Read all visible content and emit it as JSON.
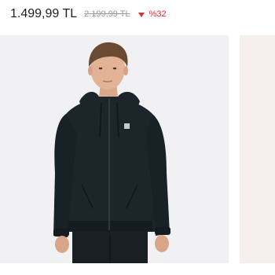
{
  "product": {
    "price_current": "1.499,99 TL",
    "price_old": "2.199,99 TL",
    "discount": "%32",
    "image_icon": "hoodie-photo",
    "image_bg": "#f1f1f3"
  },
  "colors": {
    "price": "#1d1d1f",
    "old_price": "#9a9a9a",
    "discount": "#d6303a",
    "next_card_bg": "#f6efec"
  },
  "icons": {
    "discount": "triangle-down-icon"
  }
}
